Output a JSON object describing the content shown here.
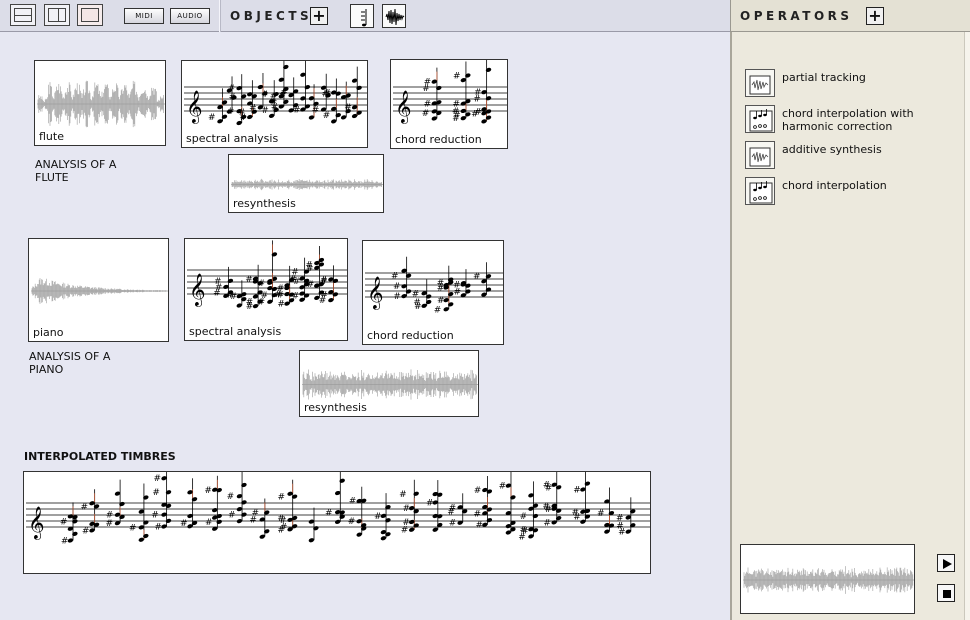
{
  "toolbar": {
    "midi_label": "MIDI",
    "audio_label": "AUDIO",
    "objects_label": "OBJECTS",
    "add_object": "+"
  },
  "operators": {
    "header": "OPERATORS",
    "add_operator": "+",
    "items": [
      {
        "label": "partial tracking",
        "icon": "waveform-doc-icon"
      },
      {
        "label": "chord interpolation with harmonic correction",
        "icon": "score-doc-icon"
      },
      {
        "label": "additive synthesis",
        "icon": "waveform-doc-icon"
      },
      {
        "label": "chord interpolation",
        "icon": "score-doc-icon"
      }
    ]
  },
  "flute": {
    "title": "ANALYSIS OF A FLUTE",
    "sound_label": "flute",
    "spectral_label": "spectral analysis",
    "chord_label": "chord reduction",
    "resynth_label": "resynthesis"
  },
  "piano": {
    "title": "ANALYSIS OF A PIANO",
    "sound_label": "piano",
    "spectral_label": "spectral analysis",
    "chord_label": "chord reduction",
    "resynth_label": "resynthesis"
  },
  "interpolated": {
    "title": "INTERPOLATED TIMBRES"
  }
}
